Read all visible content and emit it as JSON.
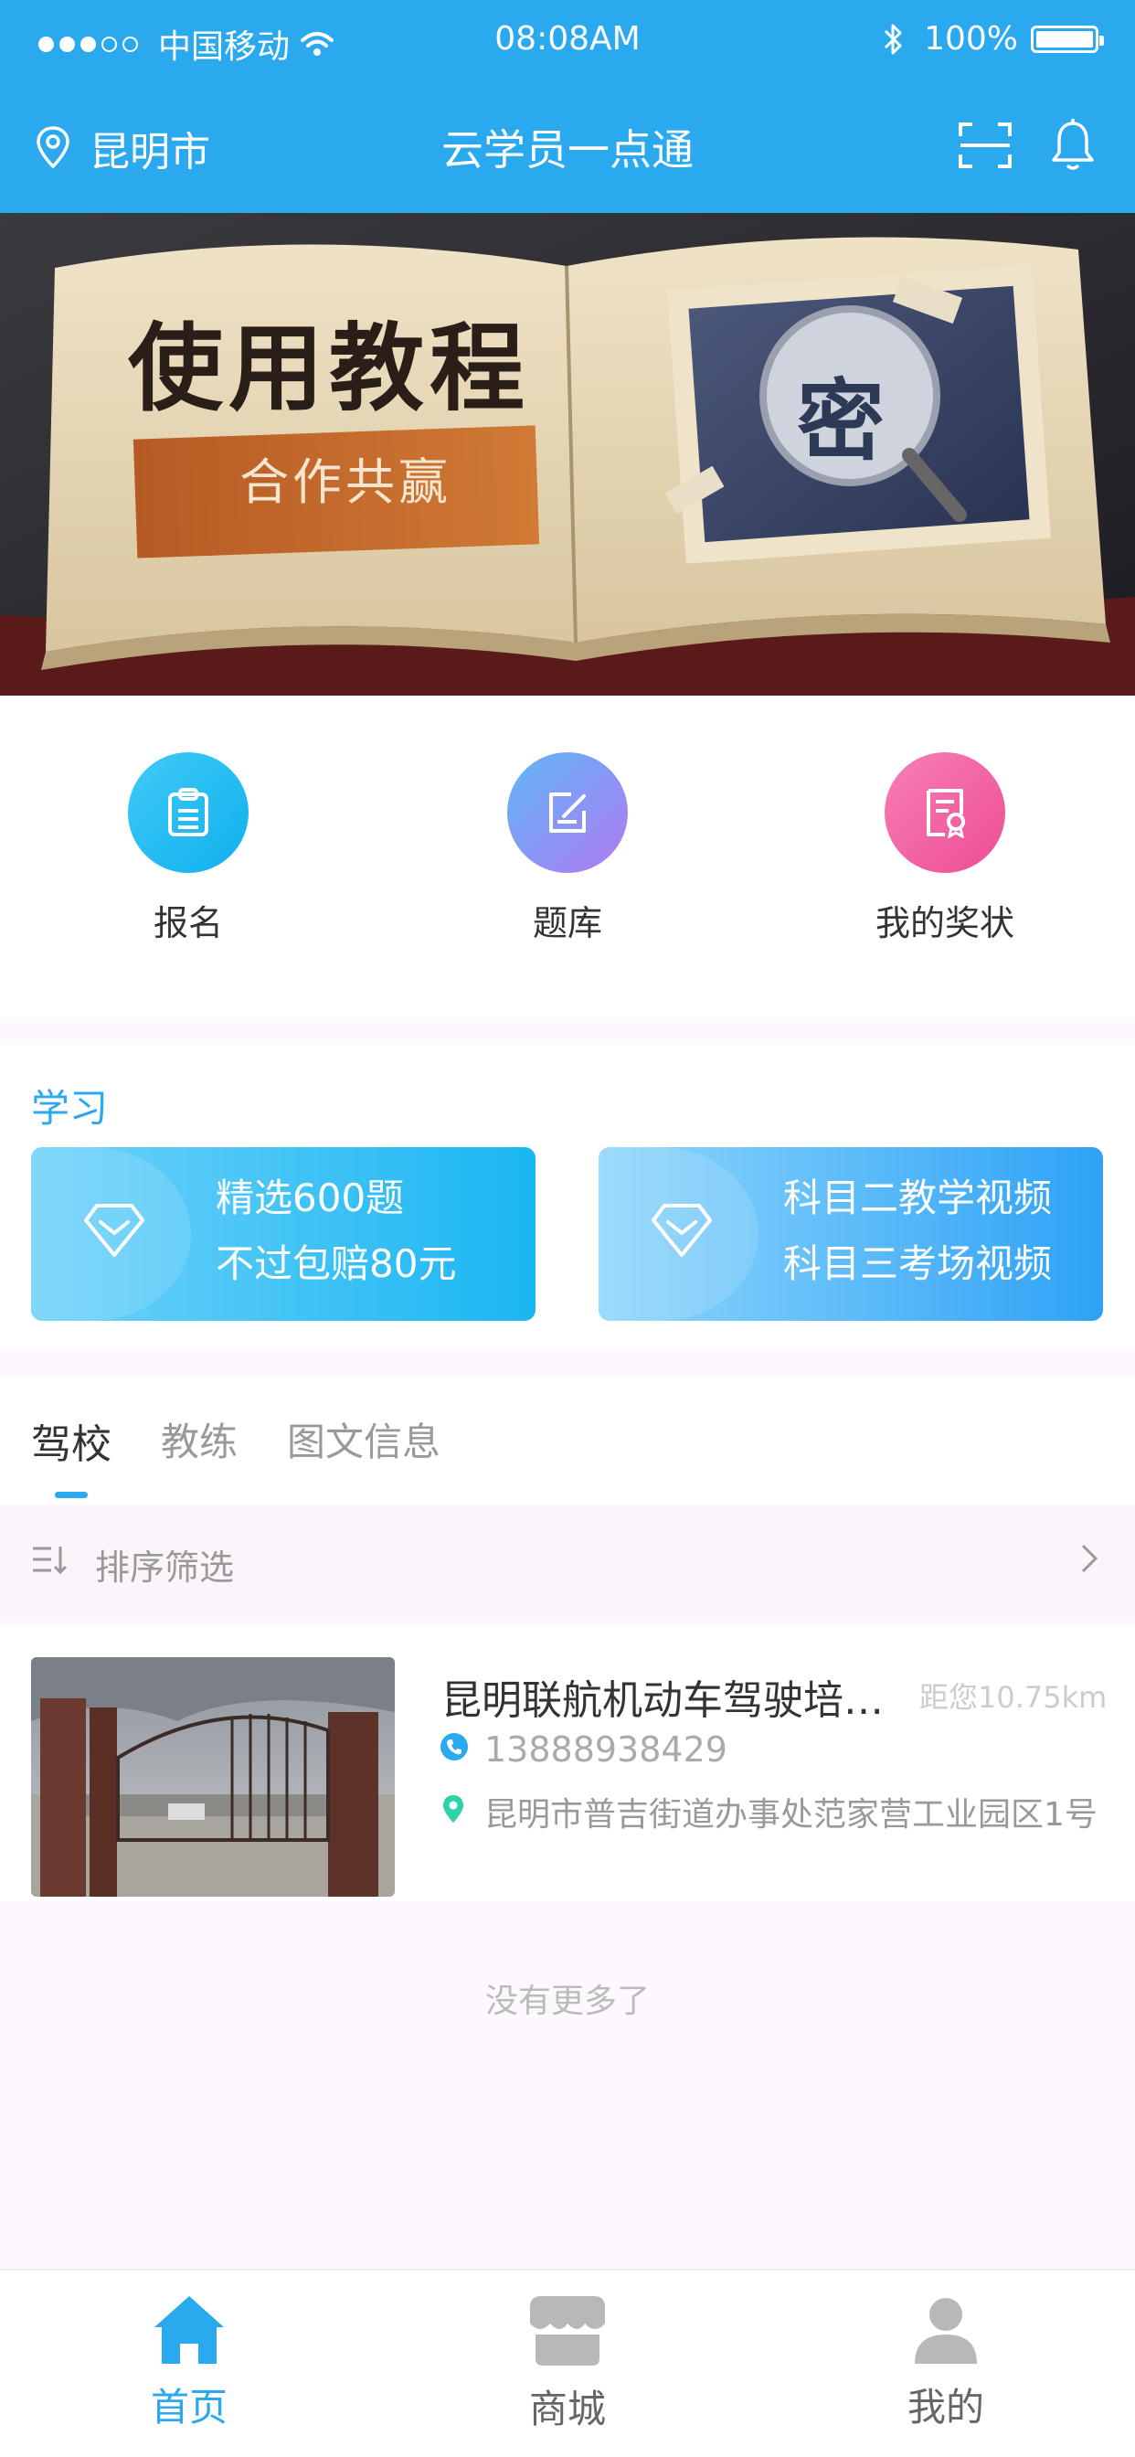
{
  "status_bar": {
    "carrier": "中国移动",
    "time": "08:08AM",
    "battery": "100%"
  },
  "nav": {
    "city": "昆明市",
    "title": "云学员一点通"
  },
  "banner": {
    "title": "使用教程",
    "subtitle": "合作共赢",
    "stamp": "密"
  },
  "quick_menu": [
    {
      "label": "报名",
      "icon": "clipboard-icon",
      "color": "#1fb8f1"
    },
    {
      "label": "题库",
      "icon": "edit-icon",
      "color": "#8c86f5"
    },
    {
      "label": "我的奖状",
      "icon": "certificate-icon",
      "color": "#f05fa3"
    }
  ],
  "study": {
    "title": "学习",
    "cards": [
      {
        "line1": "精选600题",
        "line2": "不过包赔80元"
      },
      {
        "line1": "科目二教学视频",
        "line2": "科目三考场视频"
      }
    ]
  },
  "tabs": [
    "驾校",
    "教练",
    "图文信息"
  ],
  "filter": {
    "label": "排序筛选"
  },
  "schools": [
    {
      "name": "昆明联航机动车驾驶培训有限公司",
      "distance": "距您10.75km",
      "phone": "13888938429",
      "address": "昆明市普吉街道办事处范家营工业园区1号"
    }
  ],
  "list_footer": "没有更多了",
  "tabbar": [
    {
      "label": "首页",
      "icon": "home-icon",
      "active": true
    },
    {
      "label": "商城",
      "icon": "shop-icon",
      "active": false
    },
    {
      "label": "我的",
      "icon": "user-icon",
      "active": false
    }
  ],
  "colors": {
    "primary": "#2aa9ef",
    "background": "#fdf8fd"
  }
}
